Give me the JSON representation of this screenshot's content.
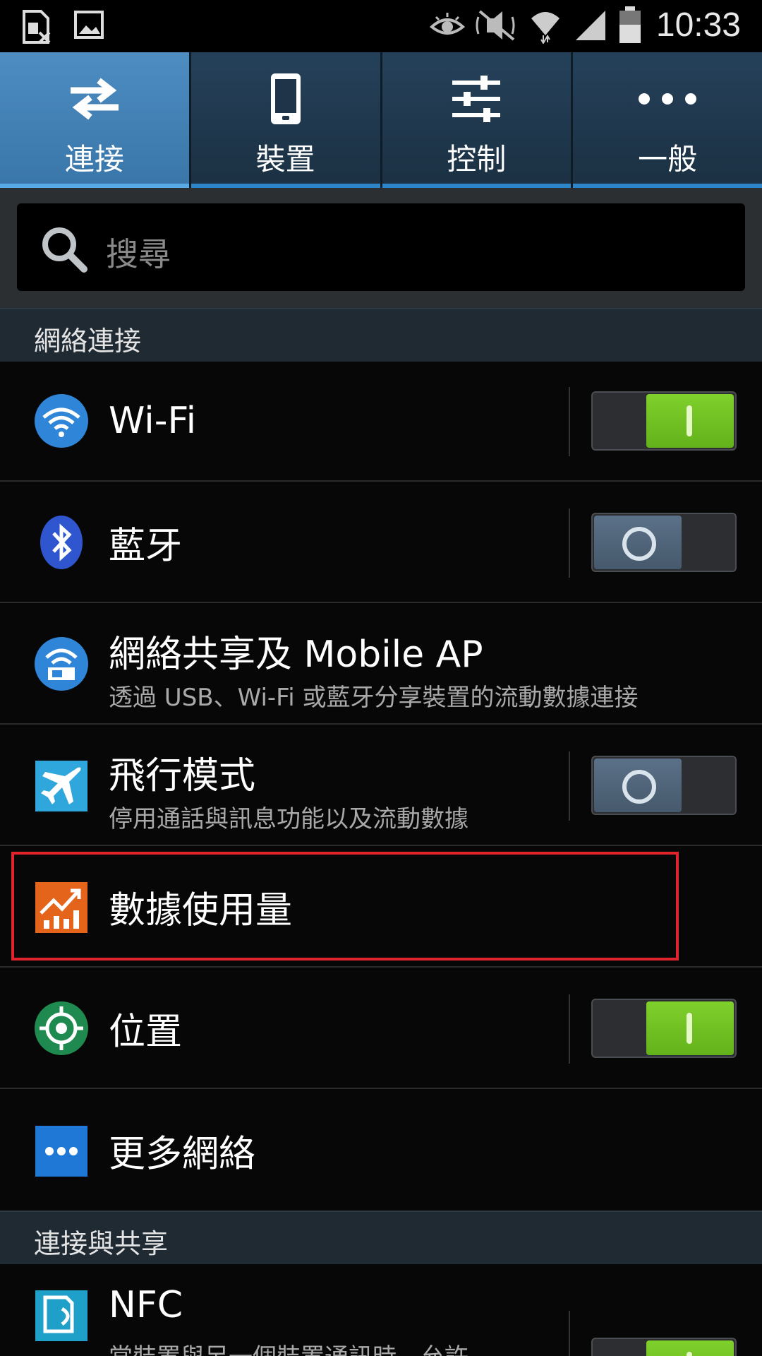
{
  "status_bar": {
    "time": "10:33",
    "icons": [
      "sim-missing-icon",
      "image-icon",
      "smart-stay-eye-icon",
      "mute-icon",
      "wifi-icon",
      "cell-signal-icon",
      "battery-icon"
    ]
  },
  "tabs": [
    {
      "label": "連接",
      "icon": "swap-arrows-icon",
      "active": true
    },
    {
      "label": "裝置",
      "icon": "phone-icon",
      "active": false
    },
    {
      "label": "控制",
      "icon": "sliders-icon",
      "active": false
    },
    {
      "label": "一般",
      "icon": "more-dots-icon",
      "active": false
    }
  ],
  "search": {
    "placeholder": "搜尋"
  },
  "sections": [
    {
      "header": "網絡連接"
    },
    {
      "header": "連接與共享"
    }
  ],
  "rows": [
    {
      "title": "Wi-Fi",
      "icon": "wifi-icon",
      "toggle": "on"
    },
    {
      "title": "藍牙",
      "icon": "bluetooth-icon",
      "toggle": "off"
    },
    {
      "title": "網絡共享及 Mobile AP",
      "subtitle": "透過 USB、Wi-Fi 或藍牙分享裝置的流動數據連接",
      "icon": "tethering-icon"
    },
    {
      "title": "飛行模式",
      "subtitle": "停用通話與訊息功能以及流動數據",
      "icon": "airplane-icon",
      "toggle": "off"
    },
    {
      "title": "數據使用量",
      "icon": "data-usage-icon",
      "highlighted": true
    },
    {
      "title": "位置",
      "icon": "location-icon",
      "toggle": "on"
    },
    {
      "title": "更多網絡",
      "icon": "more-networks-icon"
    },
    {
      "title": "NFC",
      "subtitle": "當裝置與另一個裝置通訊時，允許",
      "icon": "nfc-icon",
      "toggle": "on"
    }
  ],
  "colors": {
    "tab_active": "#3f80b6",
    "toggle_on": "#6fc022",
    "highlight_border": "#e0232d"
  }
}
